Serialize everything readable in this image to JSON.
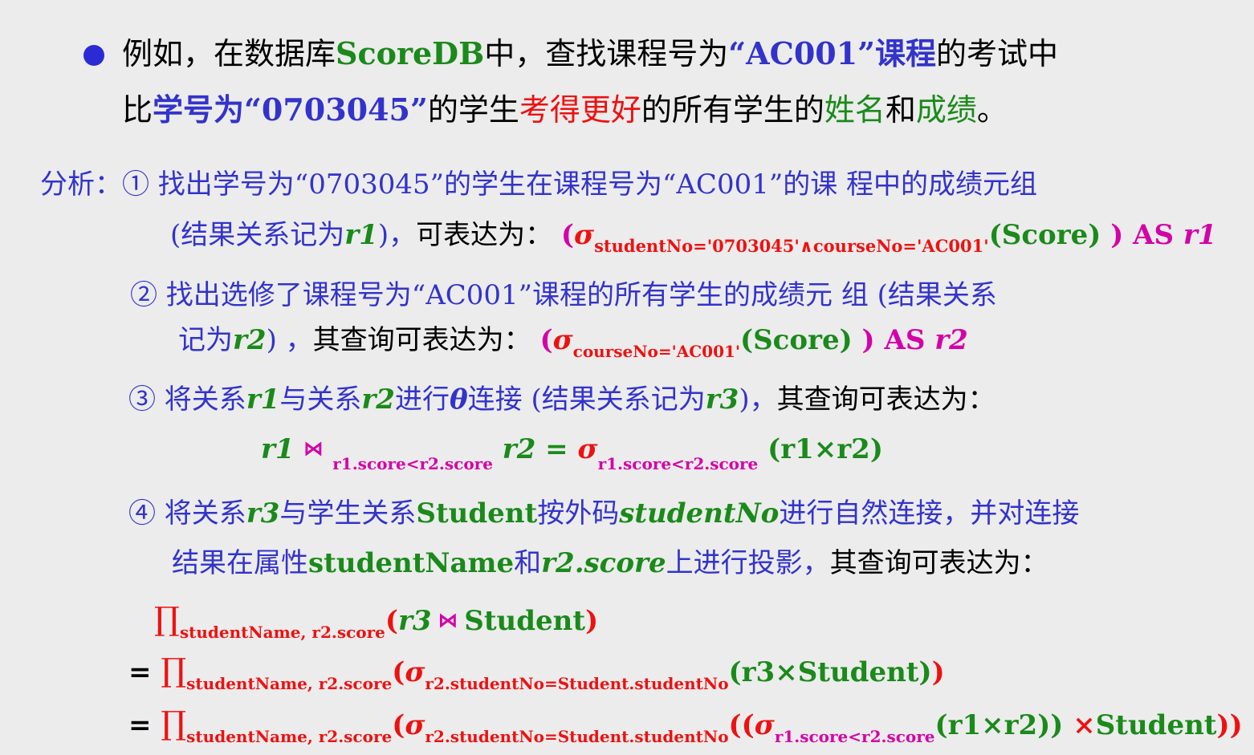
{
  "intro": {
    "l1_a": "例如，在数据库",
    "l1_db": "ScoreDB",
    "l1_b": "中，查找课程号为",
    "l1_course": "“AC001”课程",
    "l1_c": "的考试中",
    "l2_a": "比",
    "l2_sno": "学号为“0703045”",
    "l2_b": "的学生",
    "l2_better": "考得更好",
    "l2_c": "的所有学生的",
    "l2_name": "姓名",
    "l2_and": "和",
    "l2_score": "成绩",
    "l2_end": "。"
  },
  "step1": {
    "label": "分析：① 找出学号为“0703045”的学生在课程号为“AC001”的课 程中的成绩元组",
    "l2_a": "(结果关系记为",
    "l2_r": "r1",
    "l2_b": ")，",
    "l2_c": "可表达为：",
    "e_open": "(",
    "e_sigma": "σ",
    "e_sub": "studentNo='0703045'∧courseNo='AC001'",
    "e_arg": "(Score)",
    "e_as": " ) AS ",
    "e_r": "r1"
  },
  "step2": {
    "l1": "② 找出选修了课程号为“AC001”课程的所有学生的成绩元 组 (结果关系",
    "l2_a": "记为",
    "l2_r": "r2",
    "l2_b": ") ，",
    "l2_c": "其查询可表达为：",
    "e_open": "(",
    "e_sigma": "σ",
    "e_sub": "courseNo='AC001'",
    "e_arg": "(Score)",
    "e_as": " ) AS ",
    "e_r": "r2"
  },
  "step3": {
    "a": "③ 将关系",
    "r1": "r1",
    "b": "与关系",
    "r2": "r2",
    "c": "进行",
    "theta": "θ",
    "d": "连接 (结果关系记为",
    "r3": "r3",
    "e": ")，",
    "f": "其查询可表达为：",
    "eq_r1": "r1",
    "eq_join": "⋈",
    "eq_cond": "r1.score<r2.score",
    "eq_r2": " r2 = ",
    "eq_sigma": "σ",
    "eq_sub": "r1.score<r2.score",
    "eq_rest": " (r1×r2)"
  },
  "step4": {
    "a": "④ 将关系",
    "r3": "r3",
    "b": "与学生关系",
    "student": "Student",
    "c": "按外码",
    "sno": "studentNo",
    "d": "进行自然连接，并对连接",
    "l2_a": "结果在属性",
    "l2_sname": "studentName",
    "l2_b": "和",
    "l2_score": "r2.score",
    "l2_c": "上进行投影，",
    "l2_d": "其查询可表达为："
  },
  "formulas": {
    "pi": "∏",
    "pi_sub": "studentName, r2.score",
    "f1_open": "(",
    "f1_r3": "r3",
    "f1_join": " ⋈ ",
    "f1_student": "Student",
    "f1_close": ")",
    "eq": "= ",
    "sigma": "σ",
    "f2_sub": "r2.studentNo=Student.studentNo",
    "f2_inner": "(r3×Student)",
    "f2_close": ")",
    "f3_open": "((",
    "f3_sub": "r1.score<r2.score",
    "f3_inner": "(r1×r2))",
    "f3_times": " ×",
    "f3_student": "Student",
    "f3_close": "))"
  }
}
